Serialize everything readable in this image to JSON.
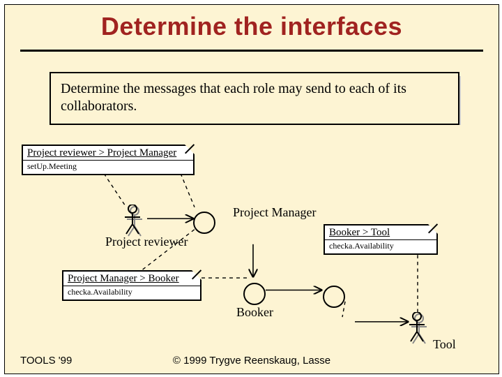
{
  "title": "Determine the interfaces",
  "intro": "Determine the messages that each role may send to each of its collaborators.",
  "notes": {
    "n1": {
      "header": "Project reviewer > Project Manager",
      "body": "setUp.Meeting"
    },
    "n2": {
      "header": "Booker > Tool",
      "body": "checka.Availability"
    },
    "n3": {
      "header": "Project Manager > Booker",
      "body": "checka.Availability"
    }
  },
  "roles": {
    "reviewer": "Project reviewer",
    "manager": "Project Manager",
    "booker": "Booker",
    "tool": "Tool"
  },
  "footer": {
    "left": "TOOLS '99",
    "center": "© 1999 Trygve Reenskaug, Lasse"
  }
}
